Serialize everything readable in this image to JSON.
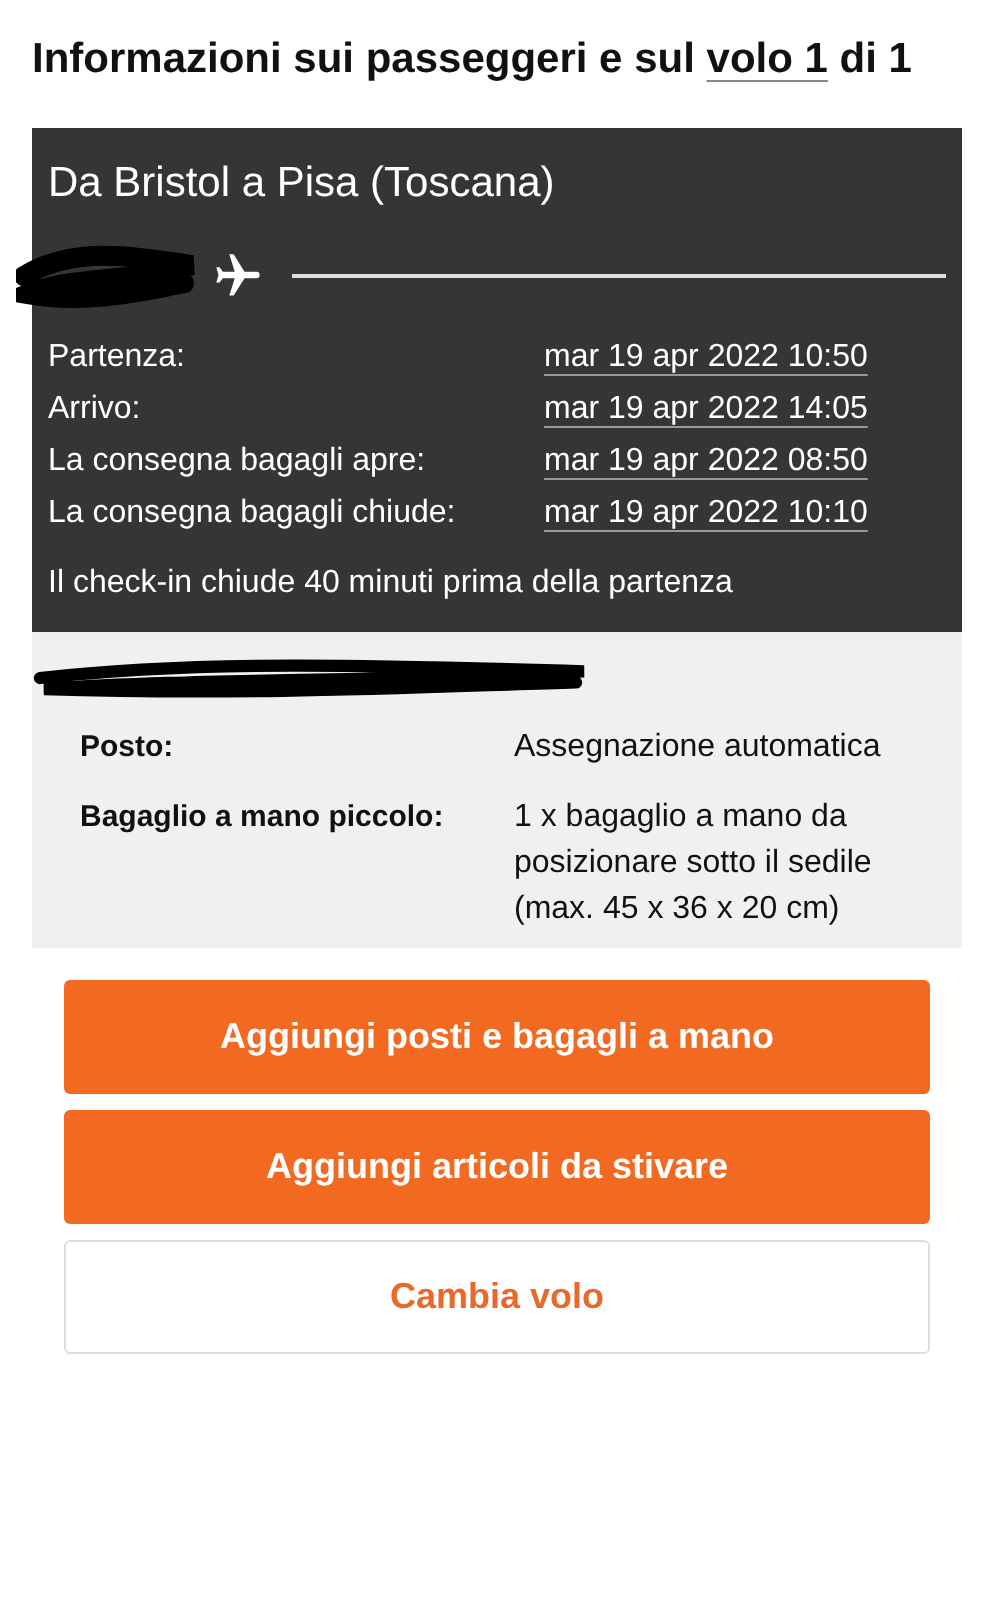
{
  "heading": {
    "before": "Informazioni sui passeggeri e sul ",
    "link": "volo 1",
    "after": " di 1"
  },
  "flight": {
    "route": "Da Bristol a Pisa (Toscana)",
    "times": [
      {
        "label": "Partenza:",
        "value": "mar 19 apr 2022 10:50"
      },
      {
        "label": "Arrivo:",
        "value": "mar 19 apr 2022 14:05"
      },
      {
        "label": "La consegna bagagli apre:",
        "value": "mar 19 apr 2022 08:50"
      },
      {
        "label": "La consegna bagagli chiude:",
        "value": "mar 19 apr 2022 10:10"
      }
    ],
    "note": "Il check-in chiude 40 minuti prima della partenza"
  },
  "passenger": {
    "details": [
      {
        "label": "Posto:",
        "lines": [
          "Assegnazione automatica"
        ]
      },
      {
        "label": "Bagaglio a mano piccolo:",
        "lines": [
          "1 x bagaglio a mano da posizionare sotto il sedile",
          "(max. 45 x 36 x 20 cm)"
        ]
      }
    ]
  },
  "buttons": [
    {
      "label": "Aggiungi posti e bagagli a mano",
      "kind": "primary"
    },
    {
      "label": "Aggiungi articoli da stivare",
      "kind": "primary"
    },
    {
      "label": "Cambia volo",
      "kind": "secondary"
    }
  ]
}
